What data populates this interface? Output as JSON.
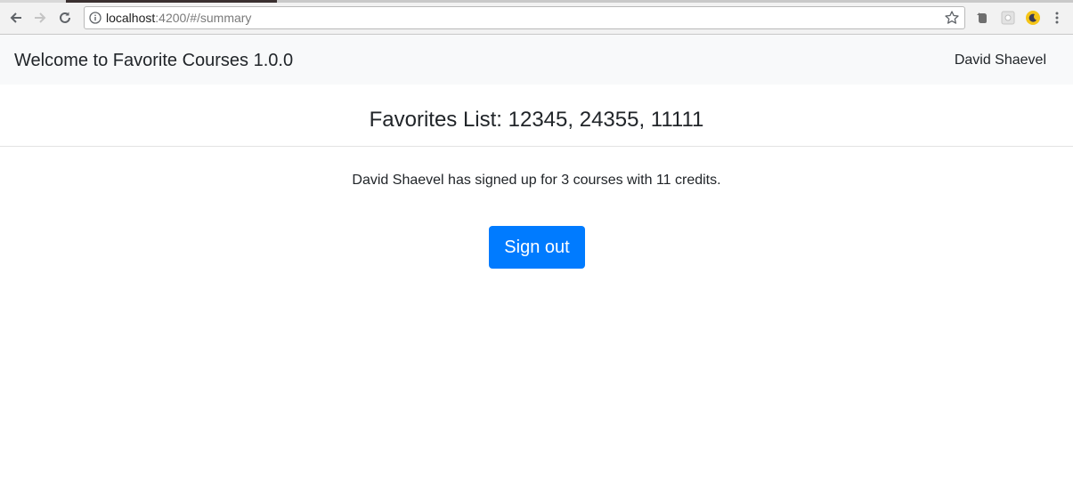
{
  "browser": {
    "url_host": "localhost",
    "url_rest": ":4200/#/summary"
  },
  "navbar": {
    "brand": "Welcome to Favorite Courses 1.0.0",
    "user": "David Shaevel"
  },
  "main": {
    "heading": "Favorites List: 12345, 24355, 11111",
    "summary": "David Shaevel has signed up for 3 courses with 11 credits.",
    "signout_label": "Sign out"
  },
  "colors": {
    "navbar_bg": "#f8f9fa",
    "primary_button": "#007bff",
    "text": "#212529"
  },
  "icons": [
    "back-arrow-icon",
    "forward-arrow-icon",
    "reload-icon",
    "info-icon",
    "bookmark-star-icon",
    "evernote-extension-icon",
    "extension-icon",
    "moon-extension-icon",
    "kebab-menu-icon"
  ]
}
